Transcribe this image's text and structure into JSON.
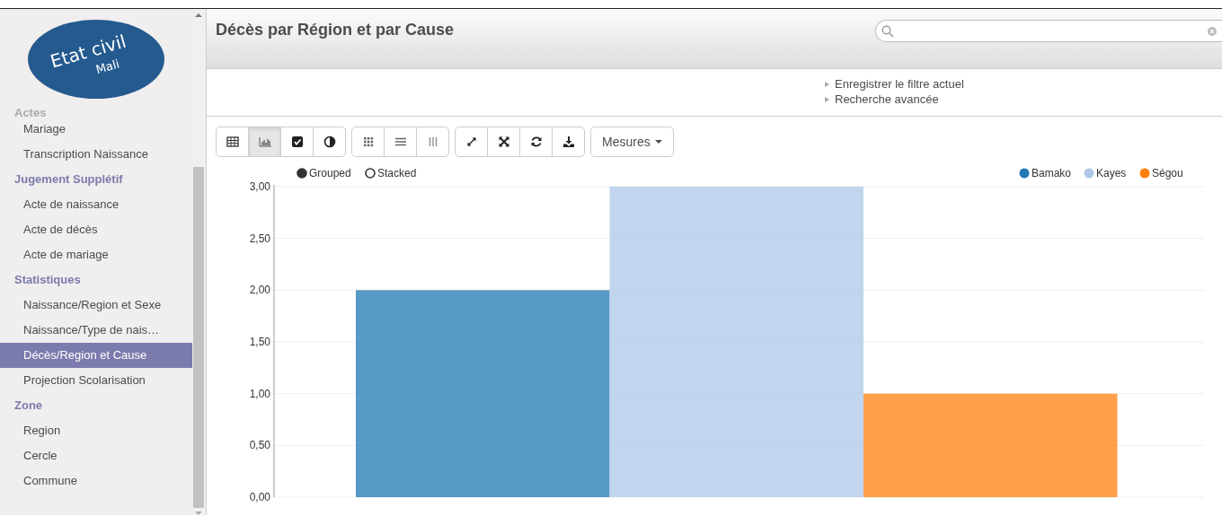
{
  "logo": {
    "title": "Etat civil",
    "subtitle": "Mali"
  },
  "sidebar": {
    "sections": [
      {
        "title": "Actes",
        "items": [
          {
            "label": "Mariage",
            "selected": false
          },
          {
            "label": "Transcription Naissance",
            "selected": false
          }
        ]
      },
      {
        "title": "Jugement Supplétif",
        "items": [
          {
            "label": "Acte de naissance",
            "selected": false
          },
          {
            "label": "Acte de décès",
            "selected": false
          },
          {
            "label": "Acte de mariage",
            "selected": false
          }
        ]
      },
      {
        "title": "Statistiques",
        "items": [
          {
            "label": "Naissance/Region et Sexe",
            "selected": false
          },
          {
            "label": "Naissance/Type de nais…",
            "selected": false
          },
          {
            "label": "Décès/Region et Cause",
            "selected": true
          },
          {
            "label": "Projection Scolarisation",
            "selected": false
          }
        ]
      },
      {
        "title": "Zone",
        "items": [
          {
            "label": "Region",
            "selected": false
          },
          {
            "label": "Cercle",
            "selected": false
          },
          {
            "label": "Commune",
            "selected": false
          }
        ]
      }
    ]
  },
  "header": {
    "title": "Décès par Région et par Cause"
  },
  "filter_links": [
    "Enregistrer le filtre actuel",
    "Recherche avancée"
  ],
  "toolbar": {
    "groups": [
      [
        {
          "selected": false
        },
        {
          "selected": true
        },
        {
          "selected": false
        },
        {
          "selected": false
        }
      ],
      [
        {
          "selected": false
        },
        {
          "selected": false
        },
        {
          "selected": false
        }
      ],
      [
        {
          "selected": false
        },
        {
          "selected": false
        },
        {
          "selected": false
        },
        {
          "selected": false
        }
      ]
    ],
    "measures_label": "Mesures"
  },
  "chart": {
    "modes": [
      {
        "label": "Grouped",
        "selected": true
      },
      {
        "label": "Stacked",
        "selected": false
      }
    ],
    "chart_data": {
      "type": "bar",
      "grid": true,
      "legend": true,
      "ylim": [
        0,
        3
      ],
      "yticks": [
        {
          "value": 0,
          "label": "0,00"
        },
        {
          "value": 0.5,
          "label": "0,50"
        },
        {
          "value": 1,
          "label": "1,00"
        },
        {
          "value": 1.5,
          "label": "1,50"
        },
        {
          "value": 2,
          "label": "2,00"
        },
        {
          "value": 2.5,
          "label": "2,50"
        },
        {
          "value": 3,
          "label": "3,00"
        }
      ],
      "series": [
        {
          "name": "Bamako",
          "color": "#1f77b4",
          "values": [
            2
          ]
        },
        {
          "name": "Kayes",
          "color": "#aec7e8",
          "values": [
            3
          ]
        },
        {
          "name": "Ségou",
          "color": "#ff7f0e",
          "values": [
            1
          ]
        }
      ]
    }
  }
}
